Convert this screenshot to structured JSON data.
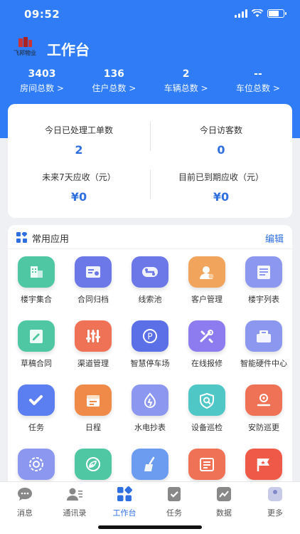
{
  "status_bar": {
    "time": "09:52"
  },
  "header": {
    "logo_text": "飞邦物业",
    "title": "工作台",
    "stats": [
      {
        "value": "3403",
        "label": "房间总数 >"
      },
      {
        "value": "136",
        "label": "住户总数 >"
      },
      {
        "value": "2",
        "label": "车辆总数 >"
      },
      {
        "value": "--",
        "label": "车位总数 >"
      }
    ]
  },
  "summary": {
    "today_orders": {
      "label": "今日已处理工单数",
      "value": "2"
    },
    "today_visitors": {
      "label": "今日访客数",
      "value": "0"
    },
    "receivable_7days": {
      "label": "未来7天应收（元）",
      "value": "¥0"
    },
    "due_receivable": {
      "label": "目前已到期应收（元）",
      "value": "¥0"
    }
  },
  "apps": {
    "title": "常用应用",
    "edit_label": "编辑",
    "items": [
      {
        "label": "楼宇集合",
        "icon": "building-icon",
        "color": "#4fc7a3"
      },
      {
        "label": "合同归档",
        "icon": "contract-archive-icon",
        "color": "#6c78e8"
      },
      {
        "label": "线索池",
        "icon": "lead-pool-icon",
        "color": "#6c78e8"
      },
      {
        "label": "客户管理",
        "icon": "customer-icon",
        "color": "#f0a45c"
      },
      {
        "label": "楼宇列表",
        "icon": "building-list-icon",
        "color": "#8c97f0"
      },
      {
        "label": "草稿合同",
        "icon": "draft-contract-icon",
        "color": "#4fc7a3"
      },
      {
        "label": "渠道管理",
        "icon": "channel-icon",
        "color": "#ef7256"
      },
      {
        "label": "智慧停车场",
        "icon": "parking-icon",
        "color": "#5b6fe6"
      },
      {
        "label": "在线报修",
        "icon": "repair-icon",
        "color": "#8c7cf0"
      },
      {
        "label": "智能硬件中心",
        "icon": "hardware-icon",
        "color": "#8c97f0"
      },
      {
        "label": "任务",
        "icon": "task-check-icon",
        "color": "#5b7ef0"
      },
      {
        "label": "日程",
        "icon": "calendar-icon",
        "color": "#f08a48"
      },
      {
        "label": "水电抄表",
        "icon": "meter-icon",
        "color": "#8c97f0"
      },
      {
        "label": "设备巡检",
        "icon": "inspection-icon",
        "color": "#4fc7c7"
      },
      {
        "label": "安防巡更",
        "icon": "patrol-icon",
        "color": "#ef7256"
      },
      {
        "label": "",
        "icon": "target-icon",
        "color": "#8c97f0"
      },
      {
        "label": "",
        "icon": "leaf-icon",
        "color": "#4fc7a3"
      },
      {
        "label": "",
        "icon": "broom-icon",
        "color": "#6c9cf0"
      },
      {
        "label": "",
        "icon": "notice-icon",
        "color": "#ef7256"
      },
      {
        "label": "",
        "icon": "flag-icon",
        "color": "#ef5a48"
      }
    ]
  },
  "tabbar": {
    "tabs": [
      {
        "label": "消息",
        "icon": "message-icon"
      },
      {
        "label": "通讯录",
        "icon": "contacts-icon"
      },
      {
        "label": "工作台",
        "icon": "workbench-icon",
        "active": true
      },
      {
        "label": "任务",
        "icon": "task-icon"
      },
      {
        "label": "数据",
        "icon": "data-icon"
      },
      {
        "label": "更多",
        "icon": "more-icon"
      }
    ]
  },
  "colors": {
    "primary": "#2f7cf6",
    "accent_text": "#2f6fe0"
  }
}
